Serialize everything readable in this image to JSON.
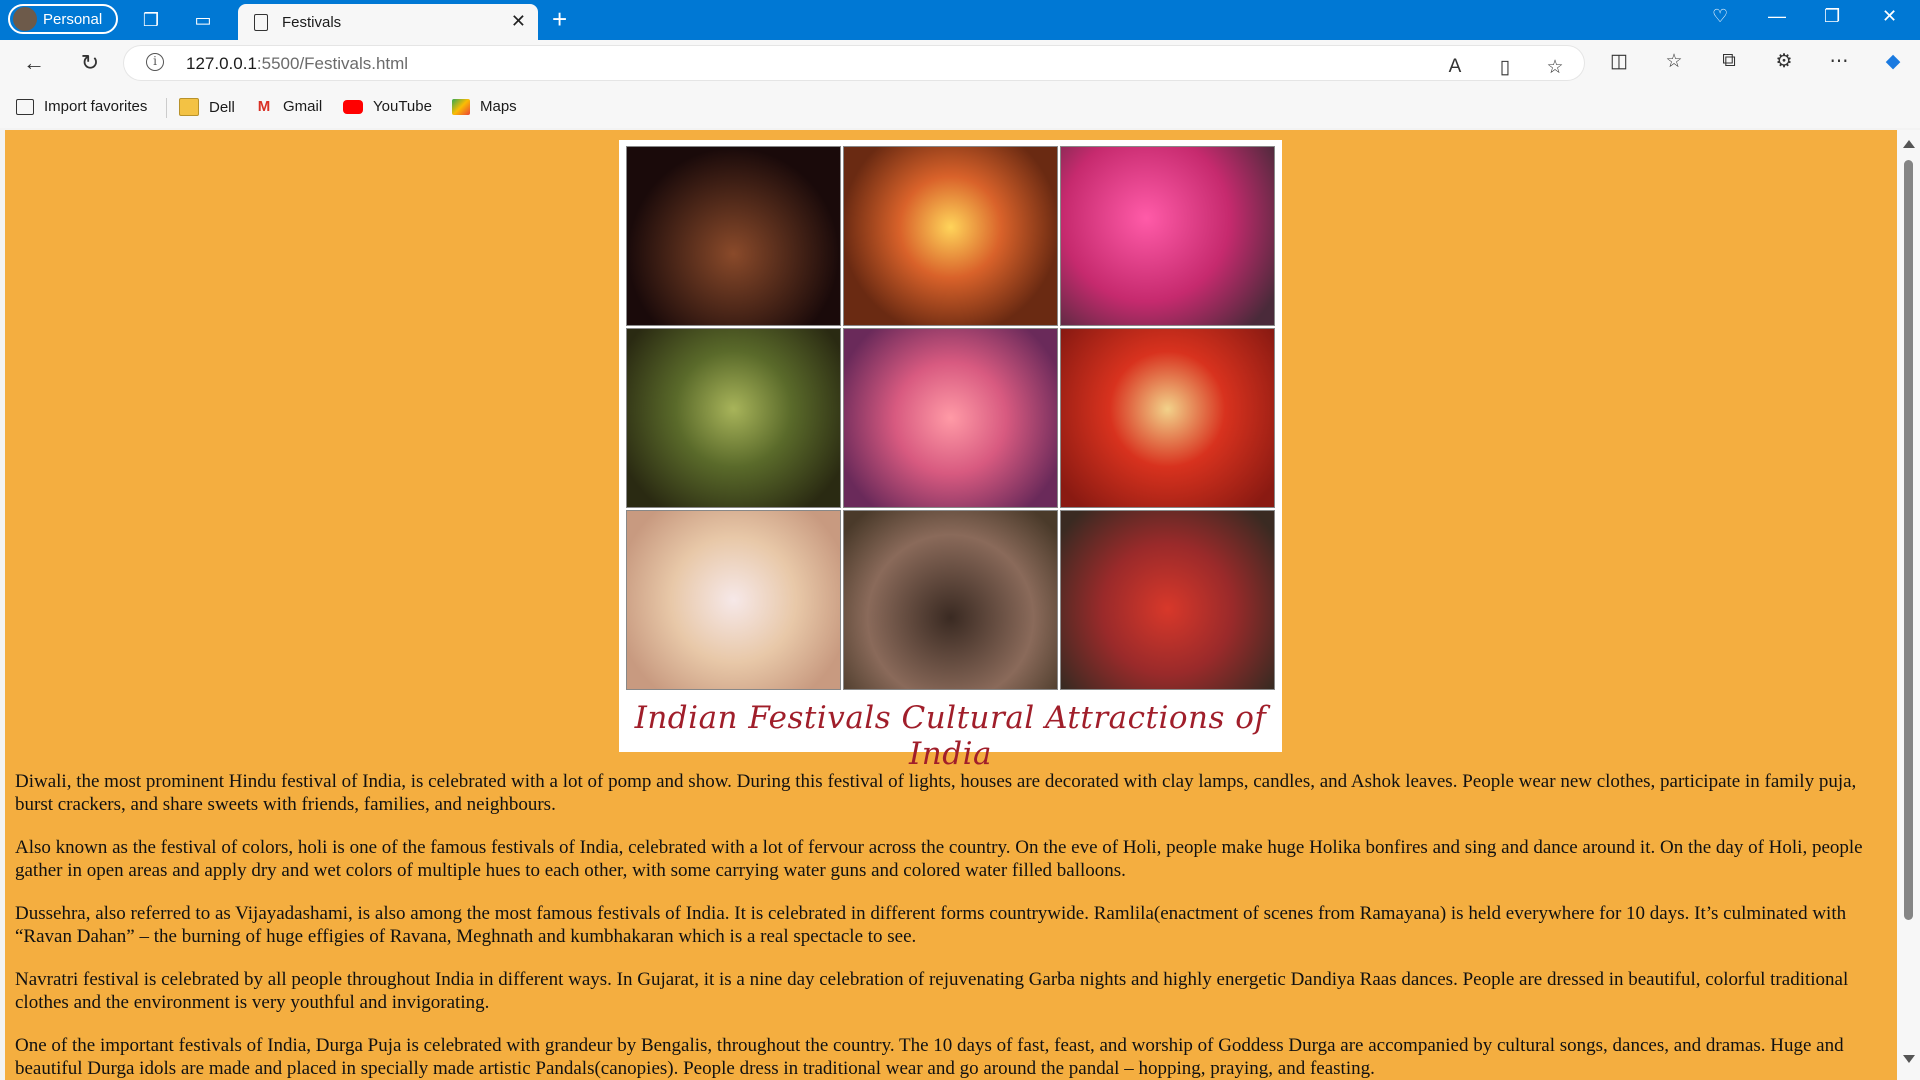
{
  "browser": {
    "profile_label": "Personal",
    "tab_title": "Festivals",
    "url_host": "127.0.0.1",
    "url_path": ":5500/Festivals.html",
    "bookmarks": [
      {
        "label": "Import favorites",
        "icon": "import-icon"
      },
      {
        "label": "Dell",
        "icon": "folder-icon"
      },
      {
        "label": "Gmail",
        "icon": "gmail-icon"
      },
      {
        "label": "YouTube",
        "icon": "youtube-icon"
      },
      {
        "label": "Maps",
        "icon": "maps-icon"
      }
    ]
  },
  "page": {
    "image_caption": "Indian Festivals Cultural Attractions of India",
    "background_color": "#f4ae40",
    "paragraphs": [
      "Diwali, the most prominent Hindu festival of India, is celebrated with a lot of pomp and show. During this festival of lights, houses are decorated with clay lamps, candles, and Ashok leaves. People wear new clothes, participate in family puja, burst crackers, and share sweets with friends, families, and neighbours.",
      "Also known as the festival of colors, holi is one of the famous festivals of India, celebrated with a lot of fervour across the country. On the eve of Holi, people make huge Holika bonfires and sing and dance around it. On the day of Holi, people gather in open areas and apply dry and wet colors of multiple hues to each other, with some carrying water guns and colored water filled balloons.",
      "Dussehra, also referred to as Vijayadashami, is also among the most famous festivals of India. It is celebrated in different forms countrywide. Ramlila(enactment of scenes from Ramayana) is held everywhere for 10 days. It’s culminated with “Ravan Dahan” – the burning of huge effigies of Ravana, Meghnath and kumbhakaran which is a real spectacle to see.",
      "Navratri festival is celebrated by all people throughout India in different ways. In Gujarat, it is a nine day celebration of rejuvenating Garba nights and highly energetic Dandiya Raas dances. People are dressed in beautiful, colorful traditional clothes and the environment is very youthful and invigorating.",
      "One of the important festivals of India, Durga Puja is celebrated with grandeur by Bengalis, throughout the country. The 10 days of fast, feast, and worship of Goddess Durga are accompanied by cultural songs, dances, and dramas. Huge and beautiful Durga idols are made and placed in specially made artistic Pandals(canopies). People dress in traditional wear and go around the pandal – hopping, praying, and feasting."
    ]
  }
}
